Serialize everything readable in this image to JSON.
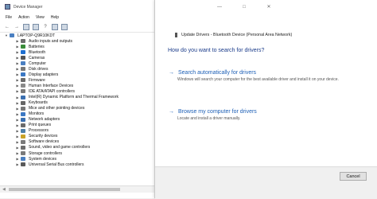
{
  "device_manager": {
    "title": "Device Manager",
    "menu": [
      "File",
      "Action",
      "View",
      "Help"
    ],
    "root": "LAPTOP-Q9R10KDT",
    "items": [
      {
        "label": "Audio inputs and outputs",
        "icon": "speaker-icon",
        "color": "#6d6d6d"
      },
      {
        "label": "Batteries",
        "icon": "battery-icon",
        "color": "#3a8c3a"
      },
      {
        "label": "Bluetooth",
        "icon": "bluetooth-icon",
        "color": "#1e6fd0"
      },
      {
        "label": "Cameras",
        "icon": "camera-icon",
        "color": "#555555"
      },
      {
        "label": "Computer",
        "icon": "computer-icon",
        "color": "#4a7fc1"
      },
      {
        "label": "Disk drives",
        "icon": "disk-icon",
        "color": "#777777"
      },
      {
        "label": "Display adapters",
        "icon": "monitor-icon",
        "color": "#3b78c4"
      },
      {
        "label": "Firmware",
        "icon": "chip-icon",
        "color": "#6b6b6b"
      },
      {
        "label": "Human Interface Devices",
        "icon": "hid-icon",
        "color": "#8a8a8a"
      },
      {
        "label": "IDE ATA/ATAPI controllers",
        "icon": "controller-icon",
        "color": "#7a7a7a"
      },
      {
        "label": "Intel(R) Dynamic Platform and Thermal Framework",
        "icon": "thermal-icon",
        "color": "#3a6fb0"
      },
      {
        "label": "Keyboards",
        "icon": "keyboard-icon",
        "color": "#666666"
      },
      {
        "label": "Mice and other pointing devices",
        "icon": "mouse-icon",
        "color": "#777777"
      },
      {
        "label": "Monitors",
        "icon": "monitor-icon",
        "color": "#3b78c4"
      },
      {
        "label": "Network adapters",
        "icon": "network-icon",
        "color": "#3a6fb0"
      },
      {
        "label": "Print queues",
        "icon": "printer-icon",
        "color": "#6b6b6b"
      },
      {
        "label": "Processors",
        "icon": "processor-icon",
        "color": "#4d7fa8"
      },
      {
        "label": "Security devices",
        "icon": "security-icon",
        "color": "#c9a227"
      },
      {
        "label": "Software devices",
        "icon": "software-icon",
        "color": "#7a7a7a"
      },
      {
        "label": "Sound, video and game controllers",
        "icon": "sound-icon",
        "color": "#6d6d6d"
      },
      {
        "label": "Storage controllers",
        "icon": "storage-icon",
        "color": "#7a7a7a"
      },
      {
        "label": "System devices",
        "icon": "system-icon",
        "color": "#4a7fc1"
      },
      {
        "label": "Universal Serial Bus controllers",
        "icon": "usb-icon",
        "color": "#5a5a5a"
      }
    ]
  },
  "update_drivers": {
    "header": "Update Drivers - Bluetooth Device (Personal Area Network)",
    "question": "How do you want to search for drivers?",
    "option_auto_title": "Search automatically for drivers",
    "option_auto_desc": "Windows will search your computer for the best available driver and install it on your device.",
    "option_manual_title": "Browse my computer for drivers",
    "option_manual_desc": "Locate and install a driver manually.",
    "cancel": "Cancel",
    "colors": {
      "link": "#1c5fb6",
      "heading": "#1a3b8a"
    }
  }
}
